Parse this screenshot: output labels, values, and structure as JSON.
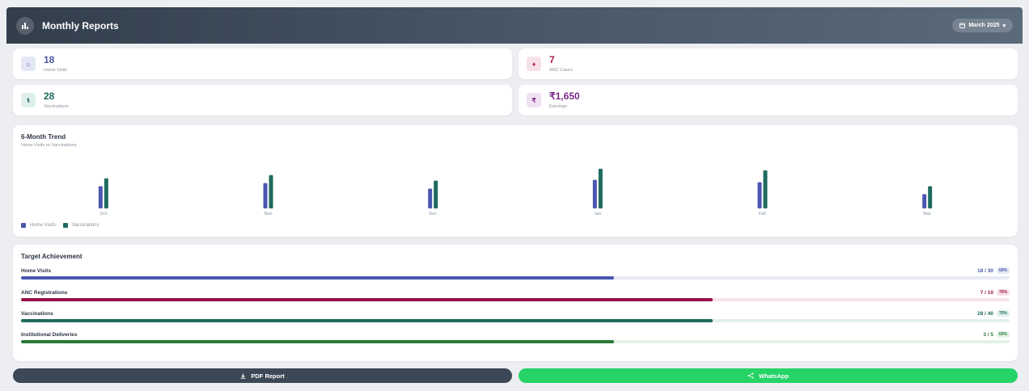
{
  "header": {
    "title": "Monthly Reports",
    "icon": "bar-chart-icon",
    "month": "March 2025"
  },
  "stats": [
    {
      "value": "18",
      "label": "Home Visits",
      "icon": "home-icon",
      "glyph": "⌂",
      "color": "#4a56a6",
      "bg": "#e4e8f6"
    },
    {
      "value": "7",
      "label": "ANC Cases",
      "icon": "pregnancy-icon",
      "glyph": "♦",
      "color": "#b01a4a",
      "bg": "#f7e1e8"
    },
    {
      "value": "28",
      "label": "Vaccinations",
      "icon": "vaccine-icon",
      "glyph": "⚕",
      "color": "#1f6a5e",
      "bg": "#dff0ec"
    },
    {
      "value": "₹1,650",
      "label": "Earnings",
      "icon": "rupee-icon",
      "glyph": "₹",
      "color": "#7a2a8a",
      "bg": "#efe1f3"
    }
  ],
  "trend": {
    "title": "6-Month Trend",
    "subtitle": "Home Visits vs Vaccinations"
  },
  "chart_data": {
    "type": "bar",
    "categories": [
      "Oct",
      "Nov",
      "Dec",
      "Jan",
      "Feb",
      "Mar"
    ],
    "series": [
      {
        "name": "Home Visits",
        "values": [
          28,
          32,
          25,
          36,
          33,
          18
        ],
        "color": "#4a56b0"
      },
      {
        "name": "Vaccinations",
        "values": [
          38,
          42,
          35,
          50,
          48,
          28
        ],
        "color": "#1f6a5e"
      }
    ],
    "ylim": [
      0,
      55
    ],
    "legend": "bottom-left"
  },
  "targets": {
    "title": "Target Achievement",
    "rows": [
      {
        "label": "Home Visits",
        "progress": "18 / 30",
        "percent": "60%",
        "fraction": 0.6,
        "color": "#4a56b0",
        "track": "#e8eaf6",
        "badge_bg": "#e4e8f6"
      },
      {
        "label": "ANC Registrations",
        "progress": "7 / 10",
        "percent": "70%",
        "fraction": 0.7,
        "color": "#9a1248",
        "track": "#f9e3ea",
        "badge_bg": "#f7e1e8"
      },
      {
        "label": "Vaccinations",
        "progress": "28 / 40",
        "percent": "70%",
        "fraction": 0.7,
        "color": "#1f6a5e",
        "track": "#e1f0ec",
        "badge_bg": "#dff0ec"
      },
      {
        "label": "Institutional Deliveries",
        "progress": "3 / 5",
        "percent": "60%",
        "fraction": 0.6,
        "color": "#2a7a3a",
        "track": "#e3f2e6",
        "badge_bg": "#e0f2e4"
      }
    ]
  },
  "actions": {
    "pdf": {
      "label": "PDF Report",
      "icon": "download-icon"
    },
    "whatsapp": {
      "label": "WhatsApp",
      "icon": "share-icon"
    }
  }
}
